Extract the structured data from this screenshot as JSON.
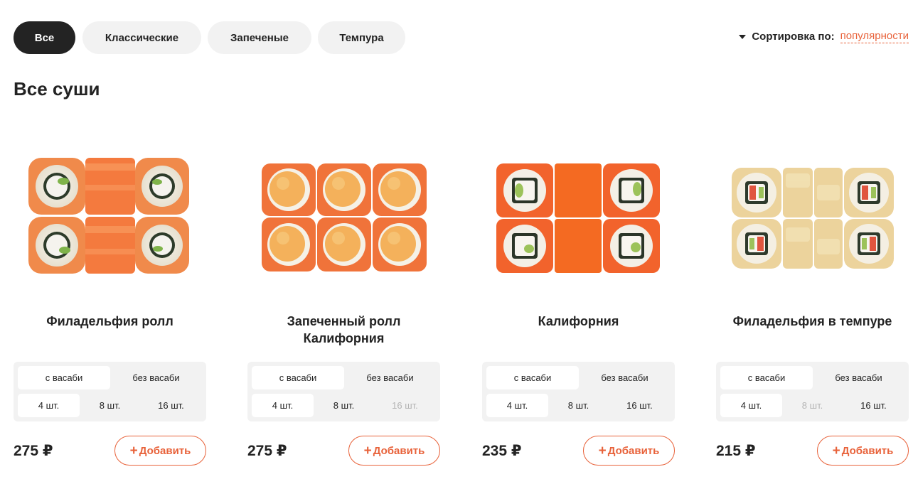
{
  "categories": [
    {
      "label": "Все",
      "active": true
    },
    {
      "label": "Классические",
      "active": false
    },
    {
      "label": "Запеченые",
      "active": false
    },
    {
      "label": "Темпура",
      "active": false
    }
  ],
  "sort": {
    "label": "Сортировка по:",
    "value": "популярности"
  },
  "page_title": "Все суши",
  "colors": {
    "accent": "#e8623a",
    "dark": "#232323",
    "chip_bg": "#f2f2f2",
    "disabled": "#b4b4b4"
  },
  "products": [
    {
      "name": "Филадельфия ролл",
      "wasabi_options": [
        "с васаби",
        "без васаби"
      ],
      "wasabi_selected": 0,
      "sizes": [
        "4 шт.",
        "8 шт.",
        "16 шт."
      ],
      "size_selected": 0,
      "size_disabled": [],
      "price": "275 ₽",
      "add_label": "Добавить",
      "image_icon": "philadelphia-roll-image"
    },
    {
      "name": "Запеченный ролл Калифорния",
      "wasabi_options": [
        "с васаби",
        "без васаби"
      ],
      "wasabi_selected": 0,
      "sizes": [
        "4 шт.",
        "8 шт.",
        "16 шт."
      ],
      "size_selected": 0,
      "size_disabled": [
        2
      ],
      "price": "275 ₽",
      "add_label": "Добавить",
      "image_icon": "baked-california-roll-image"
    },
    {
      "name": "Калифорния",
      "wasabi_options": [
        "с васаби",
        "без васаби"
      ],
      "wasabi_selected": 0,
      "sizes": [
        "4 шт.",
        "8 шт.",
        "16 шт."
      ],
      "size_selected": 0,
      "size_disabled": [],
      "price": "235 ₽",
      "add_label": "Добавить",
      "image_icon": "california-roll-image"
    },
    {
      "name": "Филадельфия в темпуре",
      "wasabi_options": [
        "с васаби",
        "без васаби"
      ],
      "wasabi_selected": 0,
      "sizes": [
        "4 шт.",
        "8 шт.",
        "16 шт."
      ],
      "size_selected": 0,
      "size_disabled": [
        1
      ],
      "price": "215 ₽",
      "add_label": "Добавить",
      "image_icon": "tempura-roll-image"
    }
  ]
}
